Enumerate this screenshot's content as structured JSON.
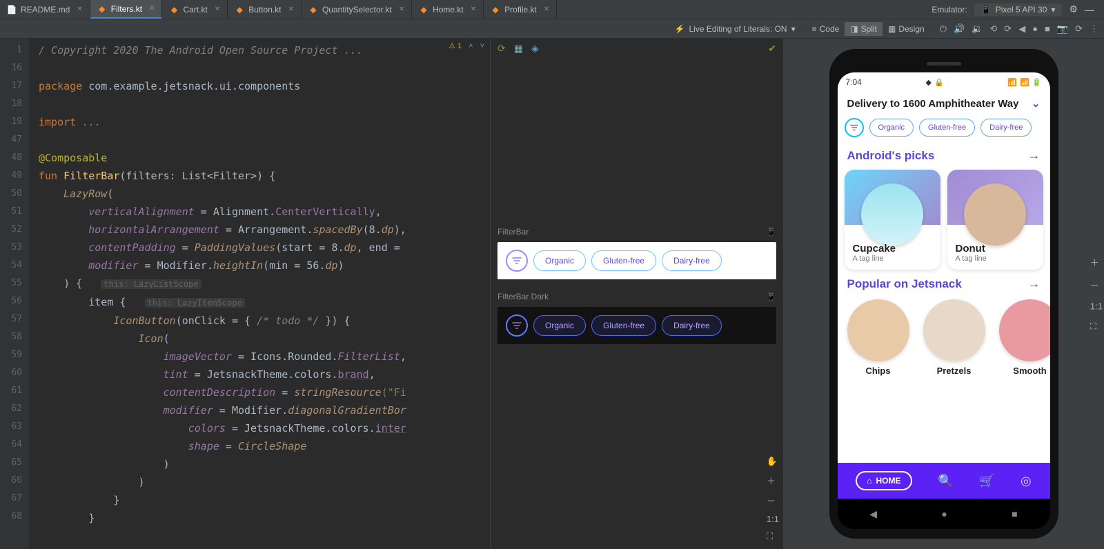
{
  "tabs": [
    {
      "name": "README.md",
      "active": false,
      "icon": "md"
    },
    {
      "name": "Filters.kt",
      "active": true,
      "icon": "kt"
    },
    {
      "name": "Cart.kt",
      "active": false,
      "icon": "kt"
    },
    {
      "name": "Button.kt",
      "active": false,
      "icon": "kt"
    },
    {
      "name": "QuantitySelector.kt",
      "active": false,
      "icon": "kt"
    },
    {
      "name": "Home.kt",
      "active": false,
      "icon": "kt"
    },
    {
      "name": "Profile.kt",
      "active": false,
      "icon": "kt"
    }
  ],
  "emulator": {
    "label": "Emulator:",
    "device": "Pixel 5 API 30"
  },
  "toolbar2": {
    "live_edit": "Live Editing of Literals: ON",
    "views": {
      "code": "Code",
      "split": "Split",
      "design": "Design"
    }
  },
  "gutter": [
    "1",
    "16",
    "17",
    "18",
    "19",
    "47",
    "48",
    "49",
    "50",
    "51",
    "52",
    "53",
    "54",
    "55",
    "56",
    "57",
    "58",
    "59",
    "60",
    "61",
    "62",
    "63",
    "64",
    "65",
    "66",
    "67",
    "68"
  ],
  "editor_status": {
    "warnings": "1"
  },
  "code": {
    "comment": "/ Copyright 2020 The Android Open Source Project ...",
    "package_kw": "package",
    "package_name": "com.example.jetsnack.ui.components",
    "import_kw": "import",
    "import_rest": "...",
    "ann": "@Composable",
    "fun_kw": "fun",
    "fun_name": "FilterBar",
    "fun_sig": "(filters: List<Filter>) {",
    "lazyrow": "LazyRow",
    "lazyrow_open": "(",
    "va_arg": "verticalAlignment",
    "va_eq": " = Alignment.",
    "va_val": "CenterVertically",
    "ha_arg": "horizontalArrangement",
    "ha_eq": " = Arrangement.",
    "ha_fn": "spacedBy",
    "ha_args": "(8.",
    "ha_dp": "dp",
    "ha_end": "),",
    "cp_arg": "contentPadding",
    "cp_eq": " = ",
    "cp_fn": "PaddingValues",
    "cp_args": "(start = 8.",
    "cp_dp": "dp",
    "cp_mid": ", end = ",
    "mod_arg": "modifier",
    "mod_eq": " = Modifier.",
    "mod_fn": "heightIn",
    "mod_args": "(min = 56.",
    "mod_dp": "dp",
    "mod_end": ")",
    "brace1": ") {",
    "hint1": "this: LazyListScope",
    "item": "item {",
    "hint2": "this: LazyItemScope",
    "iconbtn": "IconButton",
    "iconbtn_args": "(onClick = { ",
    "todo": "/* todo */",
    "iconbtn_end": " }) {",
    "icon": "Icon",
    "icon_open": "(",
    "iv_arg": "imageVector",
    "iv_eq": " = Icons.Rounded.",
    "iv_val": "FilterList",
    "tint_arg": "tint",
    "tint_eq": " = JetsnackTheme.colors.",
    "tint_val": "brand",
    "cd_arg": "contentDescription",
    "cd_eq": " = ",
    "cd_fn": "stringResource",
    "cd_args": "(\"Fi",
    "mod2_arg": "modifier",
    "mod2_eq": " = Modifier.",
    "mod2_fn": "diagonalGradientBor",
    "colors_arg": "colors",
    "colors_eq": " = JetsnackTheme.colors.",
    "colors_val": "inter",
    "shape_arg": "shape",
    "shape_eq": " = ",
    "shape_val": "CircleShape"
  },
  "previews": {
    "light": {
      "label": "FilterBar",
      "chips": [
        "Organic",
        "Gluten-free",
        "Dairy-free"
      ]
    },
    "dark": {
      "label": "FilterBar Dark",
      "chips": [
        "Organic",
        "Gluten-free",
        "Dairy-free"
      ]
    }
  },
  "app": {
    "time": "7:04",
    "delivery": "Delivery to 1600 Amphitheater Way",
    "filters": [
      "Organic",
      "Gluten-free",
      "Dairy-free"
    ],
    "section1": {
      "title": "Android's picks",
      "items": [
        {
          "name": "Cupcake",
          "sub": "A tag line"
        },
        {
          "name": "Donut",
          "sub": "A tag line"
        }
      ]
    },
    "section2": {
      "title": "Popular on Jetsnack",
      "items": [
        "Chips",
        "Pretzels",
        "Smooth"
      ]
    },
    "nav": {
      "home": "HOME"
    }
  },
  "preview_tools": {
    "ratio": "1:1"
  },
  "right_rail": {
    "ratio": "1:1"
  }
}
